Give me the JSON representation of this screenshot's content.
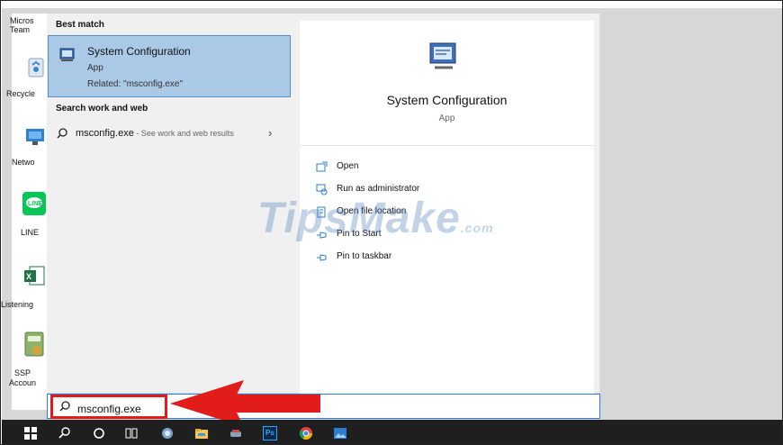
{
  "desktop_icons": [
    {
      "label": "Micros\nTeam",
      "icon": "teams-icon"
    },
    {
      "label": "Recycle",
      "icon": "recycle-bin-icon"
    },
    {
      "label": "Netwo",
      "icon": "network-icon"
    },
    {
      "label": "LINE",
      "icon": "line-app-icon"
    },
    {
      "label": "Listening",
      "icon": "excel-file-icon"
    },
    {
      "label": "SSP\nAccoun",
      "icon": "ssp-accounting-icon"
    }
  ],
  "search_results": {
    "best_match_heading": "Best match",
    "best_match": {
      "title": "System Configuration",
      "type": "App",
      "related": "Related: \"msconfig.exe\"",
      "icon": "system-configuration-icon"
    },
    "web_heading": "Search work and web",
    "web_result": {
      "query": "msconfig.exe",
      "suffix": " - See work and web results",
      "icon": "search-icon"
    }
  },
  "detail_pane": {
    "title": "System Configuration",
    "subtitle": "App",
    "icon": "system-configuration-icon",
    "actions": [
      {
        "label": "Open",
        "icon": "open-icon"
      },
      {
        "label": "Run as administrator",
        "icon": "shield-admin-icon"
      },
      {
        "label": "Open file location",
        "icon": "file-location-icon"
      },
      {
        "label": "Pin to Start",
        "icon": "pin-icon"
      },
      {
        "label": "Pin to taskbar",
        "icon": "pin-icon"
      }
    ]
  },
  "search_box": {
    "value": "msconfig.exe",
    "icon": "search-icon"
  },
  "watermark": {
    "main": "TipsMake",
    "suffix": ".com"
  },
  "taskbar": [
    "windows-start-icon",
    "search-icon",
    "cortana-icon",
    "task-view-icon",
    "app-icon",
    "file-explorer-icon",
    "app-icon",
    "photoshop-icon",
    "chrome-icon",
    "photos-icon"
  ],
  "taskbar_ps_label": "Ps",
  "colors": {
    "accent": "#2d7dd2",
    "selection": "#a9c9e6",
    "highlight_red": "#e21b1b",
    "taskbar": "#1f1f1f"
  }
}
